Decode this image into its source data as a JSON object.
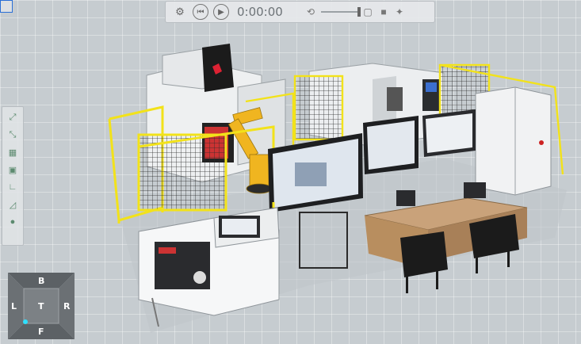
{
  "player": {
    "time": "0:00:00",
    "buttons": {
      "settings_icon": "gear-icon",
      "rewind_icon": "rewind-icon",
      "play_icon": "play-icon",
      "speed_icon": "speed-icon",
      "document_icon": "document-icon",
      "camera_icon": "video-camera-icon",
      "wand_icon": "wand-icon"
    }
  },
  "view_toolbar": {
    "items": [
      {
        "name": "fit-all-icon"
      },
      {
        "name": "fit-selection-icon"
      },
      {
        "name": "grid-view-icon"
      },
      {
        "name": "box-view-icon"
      },
      {
        "name": "axis-dropdown-icon"
      },
      {
        "name": "chart-dropdown-icon"
      },
      {
        "name": "shading-dropdown-icon"
      }
    ]
  },
  "navcube": {
    "top": "B",
    "left": "L",
    "center": "T",
    "right": "R",
    "bottom": "F"
  },
  "colors": {
    "fence": "#f2e21a",
    "robot": "#f0b520",
    "desk": "#b88e5f",
    "floor": "#c6ccd0"
  }
}
